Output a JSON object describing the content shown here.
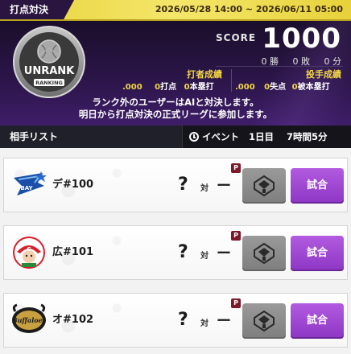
{
  "header": {
    "title": "打点対決",
    "date_range": "2026/05/28 14:00 ~ 2026/06/11 05:00"
  },
  "rank": {
    "label": "UNRANK",
    "sub_label": "RANKING"
  },
  "score": {
    "label": "SCORE",
    "value": "1000",
    "wins": "0",
    "wins_unit": "勝",
    "losses": "0",
    "losses_unit": "敗",
    "draws": "0",
    "draws_unit": "分"
  },
  "batter_stats": {
    "title": "打者成績",
    "avg": ".000",
    "rbi": "0",
    "rbi_label": "打点",
    "hr": "0",
    "hr_label": "本塁打"
  },
  "pitcher_stats": {
    "title": "投手成績",
    "era": ".000",
    "runs": "0",
    "runs_label": "失点",
    "hr_allowed": "0",
    "hr_allowed_label": "被本塁打"
  },
  "info": {
    "line1": "ランク外のユーザーはAIと対決します。",
    "line2": "明日から打点対決の正式リーグに参加します。"
  },
  "list": {
    "title": "相手リスト",
    "event_label": "イベント",
    "day": "1日目",
    "time_left": "7時間5分"
  },
  "opponents": [
    {
      "name": "デ#100",
      "question": "?",
      "vs": "対",
      "result": "ー",
      "p_badge": "P",
      "match_label": "試合",
      "logo": "baystars-logo",
      "team_color": "#1a4ea8"
    },
    {
      "name": "広#101",
      "question": "?",
      "vs": "対",
      "result": "ー",
      "p_badge": "P",
      "match_label": "試合",
      "logo": "carp-logo",
      "team_color": "#d81e28"
    },
    {
      "name": "オ#102",
      "question": "?",
      "vs": "対",
      "result": "ー",
      "p_badge": "P",
      "match_label": "試合",
      "logo": "buffaloes-logo",
      "team_color": "#1b1b1b"
    }
  ]
}
